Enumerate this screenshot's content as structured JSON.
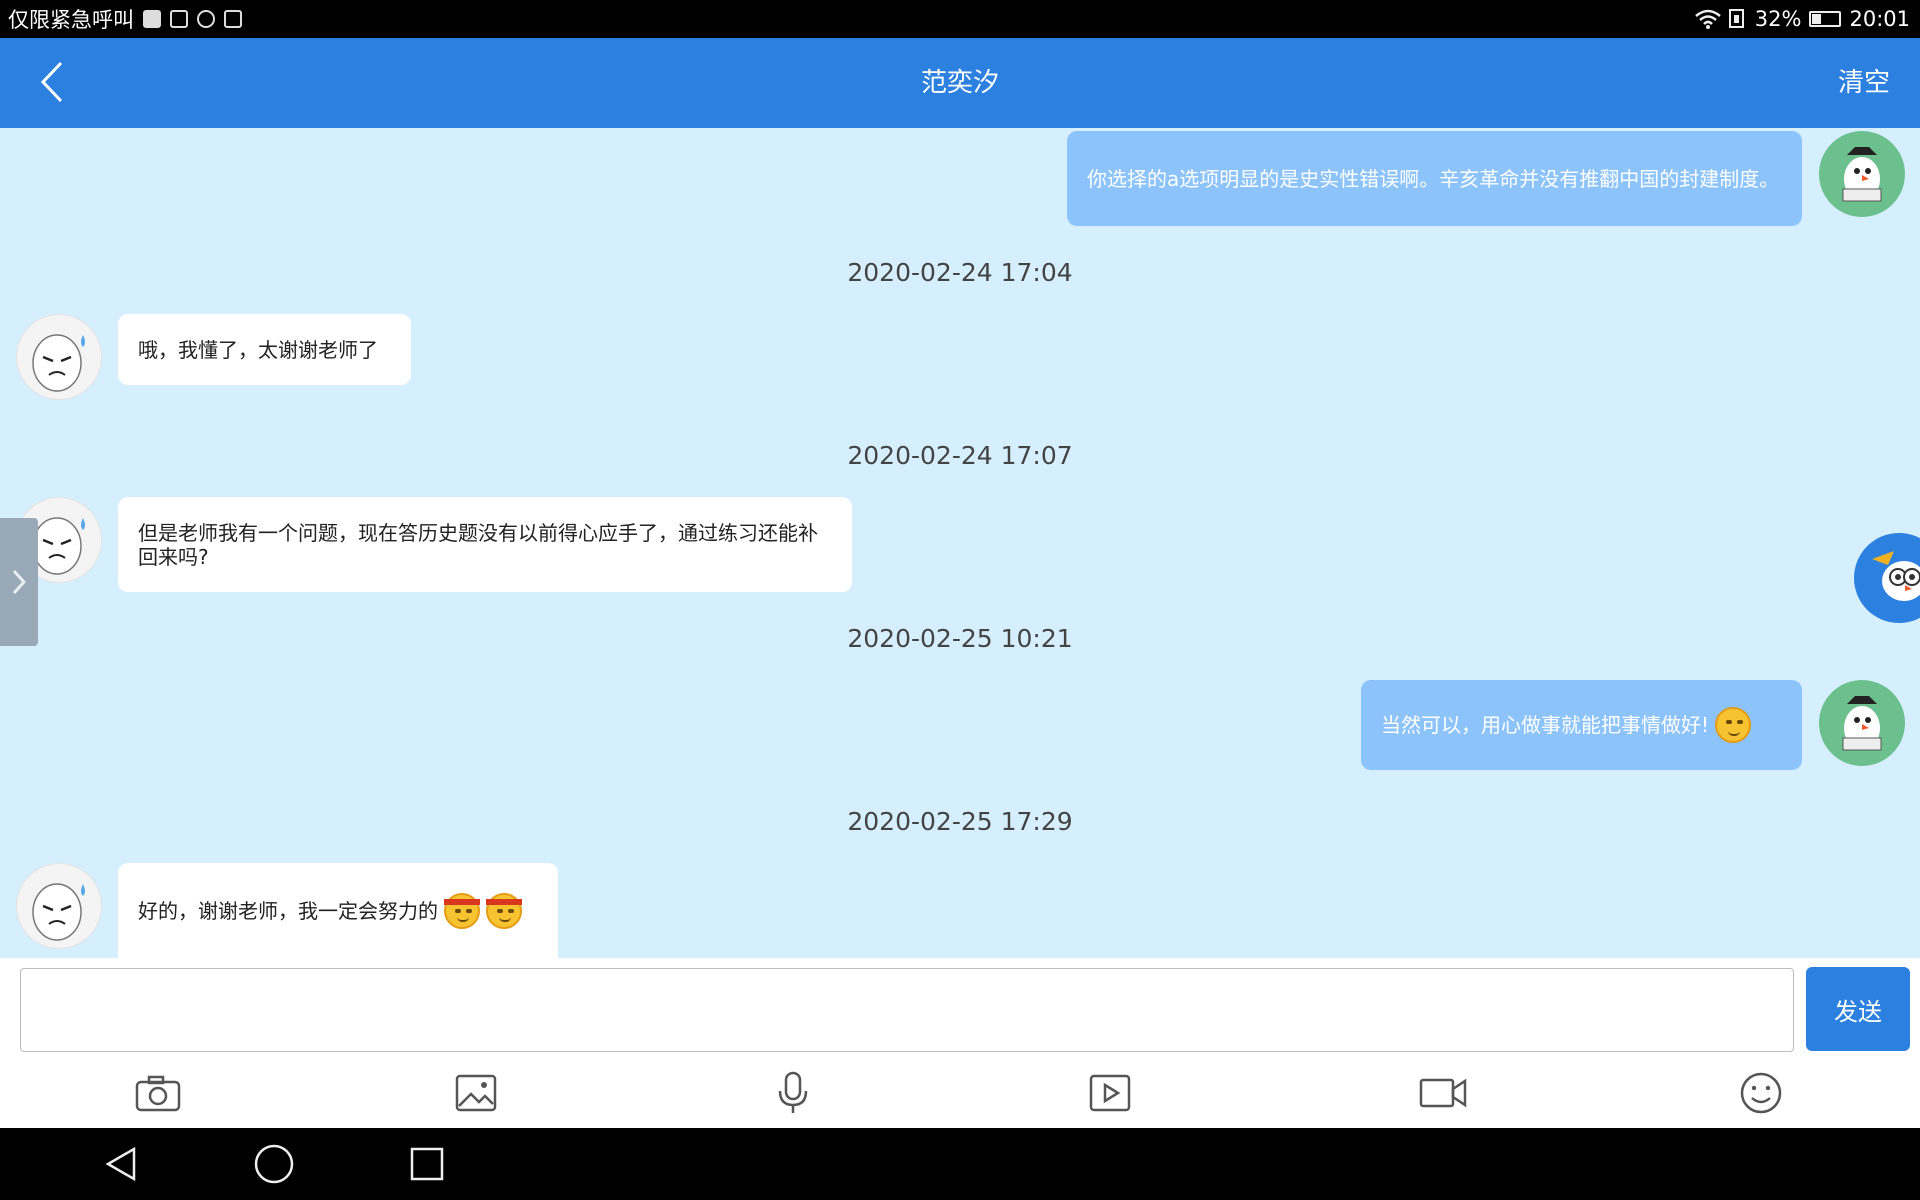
{
  "status_bar": {
    "carrier": "仅限紧急呼叫",
    "battery": "32%",
    "battery_level": 0.32,
    "time": "20:01"
  },
  "header": {
    "title": "范奕汐",
    "clear_label": "清空"
  },
  "messages": [
    {
      "side": "right",
      "text": "你选择的a选项明显的是史实性错误啊。辛亥革命并没有推翻中国的封建制度。"
    },
    {
      "timestamp": "2020-02-24 17:04"
    },
    {
      "side": "left",
      "text": "哦，我懂了，太谢谢老师了"
    },
    {
      "timestamp": "2020-02-24 17:07"
    },
    {
      "side": "left",
      "text": "但是老师我有一个问题，现在答历史题没有以前得心应手了，通过练习还能补回来吗?"
    },
    {
      "timestamp": "2020-02-25 10:21"
    },
    {
      "side": "right",
      "text": "当然可以，用心做事就能把事情做好!"
    },
    {
      "timestamp": "2020-02-25 17:29"
    },
    {
      "side": "left",
      "text": "好的，谢谢老师，我一定会努力的"
    }
  ],
  "input": {
    "value": "",
    "send_label": "发送"
  },
  "toolbar_icons": [
    "camera-icon",
    "image-icon",
    "microphone-icon",
    "video-play-icon",
    "video-camera-icon",
    "emoji-icon"
  ],
  "colors": {
    "header": "#2b80e0",
    "chat_background": "#d6effe",
    "outgoing_bubble": "#8cc3fb",
    "incoming_bubble": "#ffffff"
  }
}
